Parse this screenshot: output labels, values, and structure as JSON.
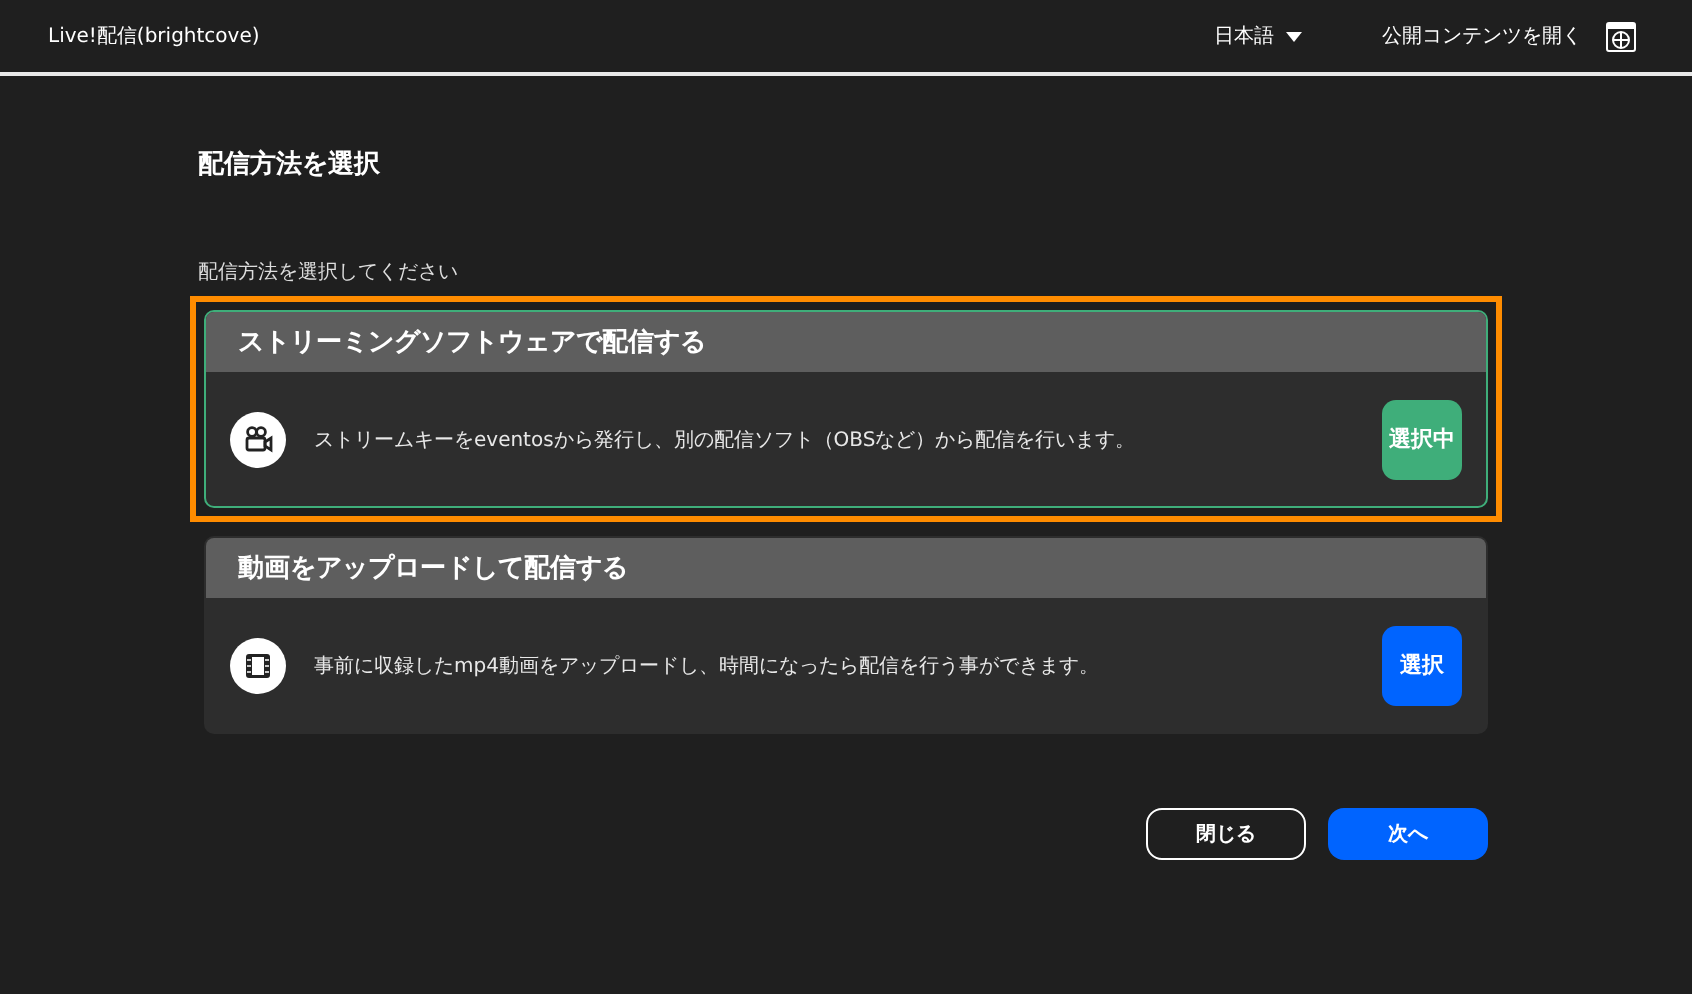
{
  "header": {
    "title": "Live!配信(brightcove)",
    "language": "日本語",
    "public_link": "公開コンテンツを開く"
  },
  "page_title": "配信方法を選択",
  "prompt": "配信方法を選択してください",
  "options": [
    {
      "kind": "streaming",
      "title": "ストリーミングソフトウェアで配信する",
      "description": "ストリームキーをeventosから発行し、別の配信ソフト（OBSなど）から配信を行います。",
      "button": "選択中",
      "selected": true
    },
    {
      "kind": "upload",
      "title": "動画をアップロードして配信する",
      "description": "事前に収録したmp4動画をアップロードし、時間になったら配信を行う事ができます。",
      "button": "選択",
      "selected": false
    }
  ],
  "buttons": {
    "close": "閉じる",
    "next": "次へ"
  }
}
